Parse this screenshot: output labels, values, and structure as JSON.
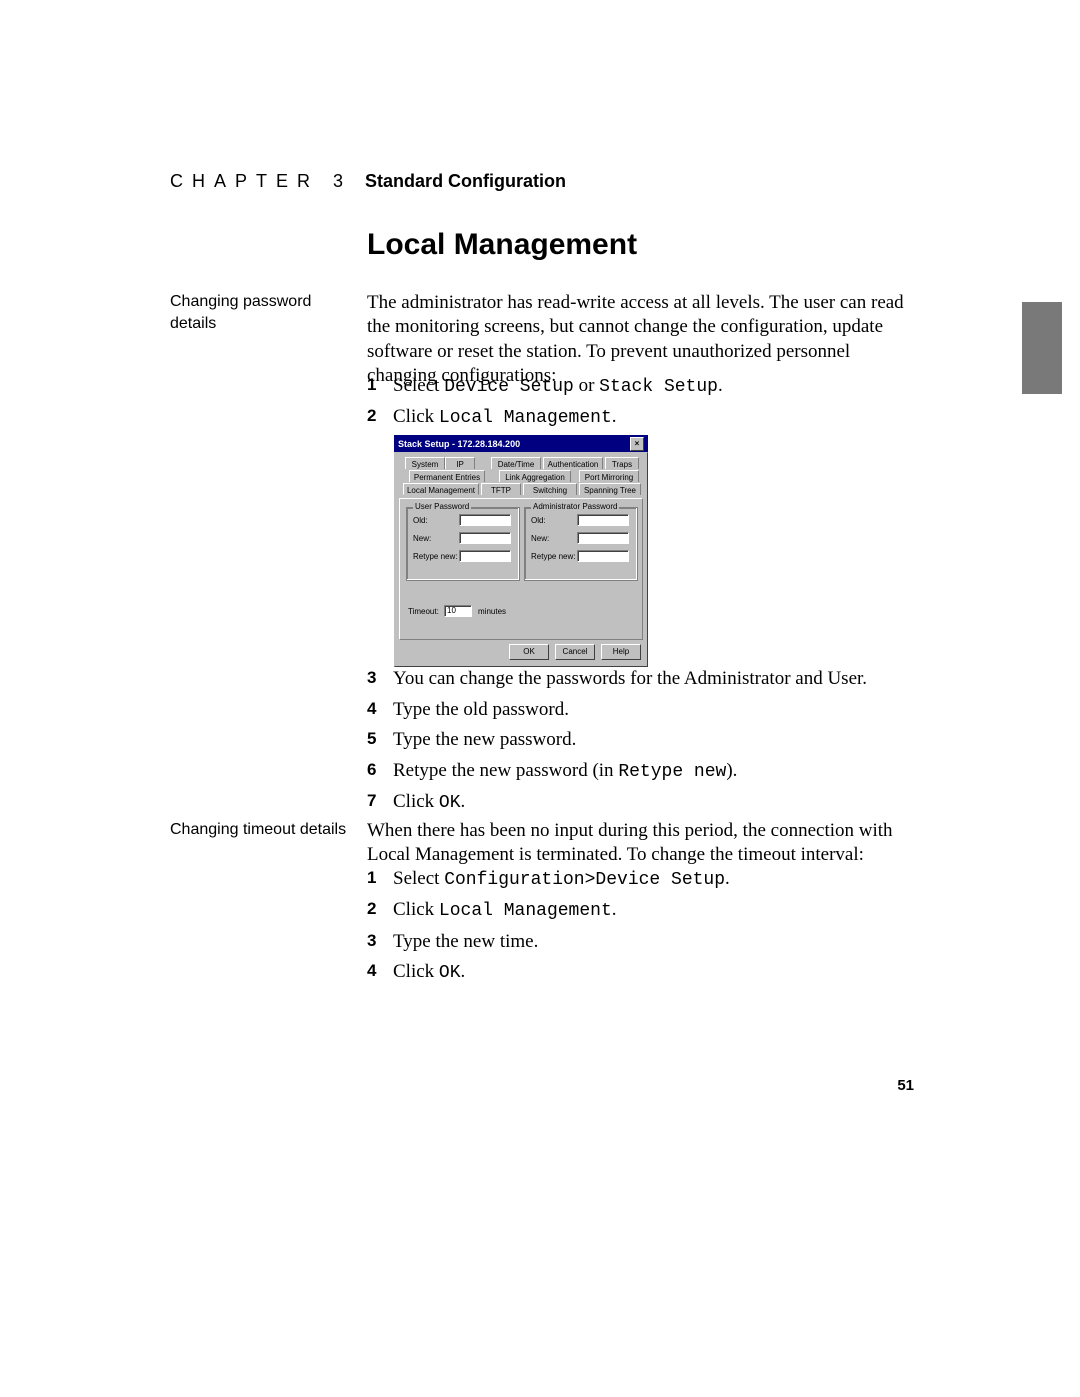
{
  "header": {
    "chapter_word": "CHAPTER 3",
    "chapter_title": "Standard Configuration"
  },
  "heading": "Local Management",
  "sections": {
    "changing_password": {
      "side_label": "Changing password details",
      "body": "The administrator has read-write access at all levels. The user can read the monitoring screens, but cannot change the configuration, update software or reset the station. To prevent unauthorized personnel changing configurations:",
      "steps_a": [
        {
          "n": "1",
          "pre": "Select ",
          "codes": [
            "Device Setup",
            " or ",
            "Stack Setup"
          ],
          "post": "."
        },
        {
          "n": "2",
          "pre": "Click ",
          "codes": [
            "Local Management"
          ],
          "post": "."
        }
      ],
      "steps_b": [
        {
          "n": "3",
          "text": "You can change the passwords for the Administrator and User."
        },
        {
          "n": "4",
          "text": "Type the old password."
        },
        {
          "n": "5",
          "text": "Type the new password."
        },
        {
          "n": "6",
          "pre": "Retype the new password (in ",
          "codes": [
            "Retype new"
          ],
          "post": ")."
        },
        {
          "n": "7",
          "pre": "Click ",
          "codes": [
            "OK"
          ],
          "post": "."
        }
      ]
    },
    "changing_timeout": {
      "side_label": "Changing timeout details",
      "body": "When there has been no input during this period, the connection with Local Management is terminated. To change the timeout interval:",
      "steps": [
        {
          "n": "1",
          "pre": "Select ",
          "codes": [
            "Configuration>Device Setup"
          ],
          "post": "."
        },
        {
          "n": "2",
          "pre": "Click ",
          "codes": [
            "Local Management"
          ],
          "post": "."
        },
        {
          "n": "3",
          "text": "Type the new time."
        },
        {
          "n": "4",
          "pre": "Click ",
          "codes": [
            "OK"
          ],
          "post": "."
        }
      ]
    }
  },
  "dialog": {
    "title": "Stack Setup - 172.28.184.200",
    "tabs_row1": [
      "System",
      "IP",
      "Date/Time",
      "Authentication",
      "Traps"
    ],
    "tabs_row2": [
      "Permanent Entries",
      "Link Aggregation",
      "Port Mirroring"
    ],
    "tabs_row3": [
      "Local Management",
      "TFTP",
      "Switching",
      "Spanning Tree"
    ],
    "selected_tab": "Local Management",
    "group_user": "User Password",
    "group_admin": "Administrator Password",
    "field_old": "Old:",
    "field_new": "New:",
    "field_retype": "Retype new:",
    "timeout_label": "Timeout:",
    "timeout_value": "10",
    "timeout_unit": "minutes",
    "btn_ok": "OK",
    "btn_cancel": "Cancel",
    "btn_help": "Help",
    "close_x": "×"
  },
  "page_number": "51"
}
